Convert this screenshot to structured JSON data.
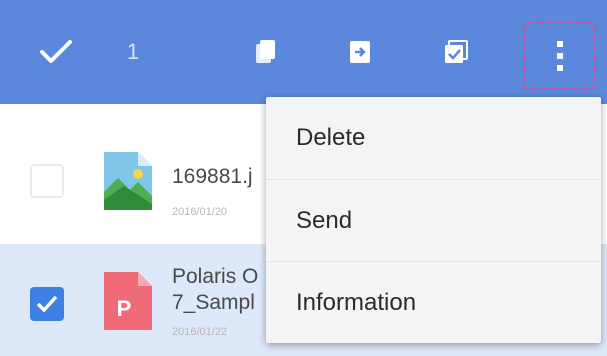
{
  "toolbar": {
    "selected_count": "1",
    "icons": [
      "check-icon",
      "copy-icon",
      "move-icon",
      "select-all-icon",
      "more-vertical-icon"
    ],
    "background_color": "#5b88dd"
  },
  "files": [
    {
      "name": "169881.j",
      "date": "2016/01/20",
      "checked": false,
      "type": "image"
    },
    {
      "name_line1": "Polaris O",
      "name_line2": "7_Sampl",
      "date": "2016/01/22",
      "checked": true,
      "type": "pdf-p"
    }
  ],
  "menu": {
    "items": [
      "Delete",
      "Send",
      "Information"
    ]
  },
  "colors": {
    "accent": "#3f7fe6",
    "selected_row": "#dde8f9",
    "highlight_border": "#d0509a"
  }
}
